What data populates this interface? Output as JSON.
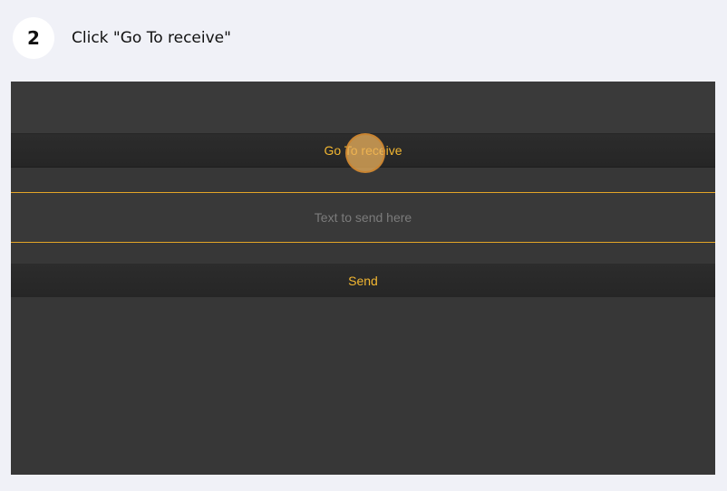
{
  "step": {
    "number": "2",
    "instruction": "Click \"Go To receive\""
  },
  "app": {
    "nav_button_label": "Go To receive",
    "text_input_placeholder": "Text to send here",
    "text_input_value": "",
    "send_button_label": "Send"
  },
  "colors": {
    "accent": "#f3b731",
    "input_border": "#e3a527",
    "screen_background": "#373737",
    "page_background": "#f0f1f7"
  }
}
